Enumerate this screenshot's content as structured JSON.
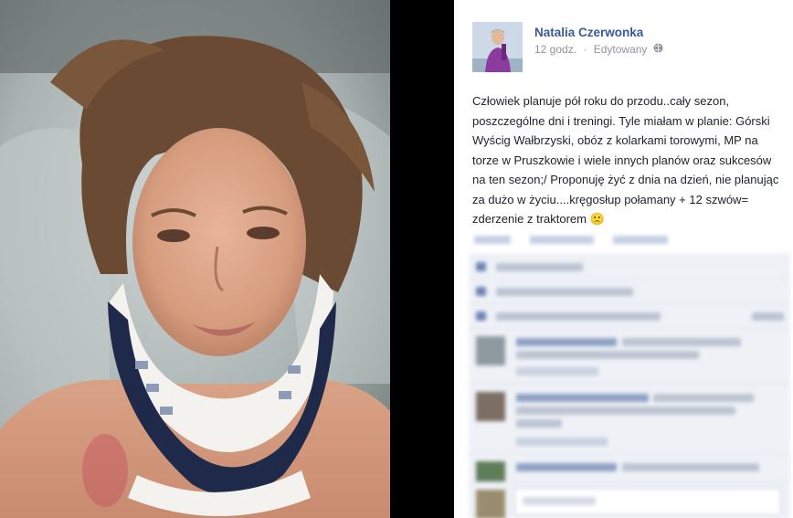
{
  "post": {
    "author": "Natalia Czerwonka",
    "time": "12 godz.",
    "separator": "·",
    "edited": "Edytowany",
    "text": "Człowiek planuje pół roku do przodu..cały sezon, poszczególne dni i treningi. Tyle miałam w planie: Górski Wyścig Wałbrzyski, obóz z kolarkami torowymi, MP na torze w Pruszkowie i wiele innych planów oraz sukcesów na ten sezon;/ Proponuję żyć z dnia na dzień, nie planując za dużo w życiu....kręgosłup połamany + 12 szwów= zderzenie z traktorem",
    "emoji": "🙁"
  },
  "icons": {
    "globe": "globe-icon",
    "thumb": "thumbs-up-icon",
    "share": "share-icon",
    "comment": "comment-icon"
  },
  "colors": {
    "link": "#3b5998",
    "meta": "#90949c",
    "panel": "#eef1f6"
  }
}
